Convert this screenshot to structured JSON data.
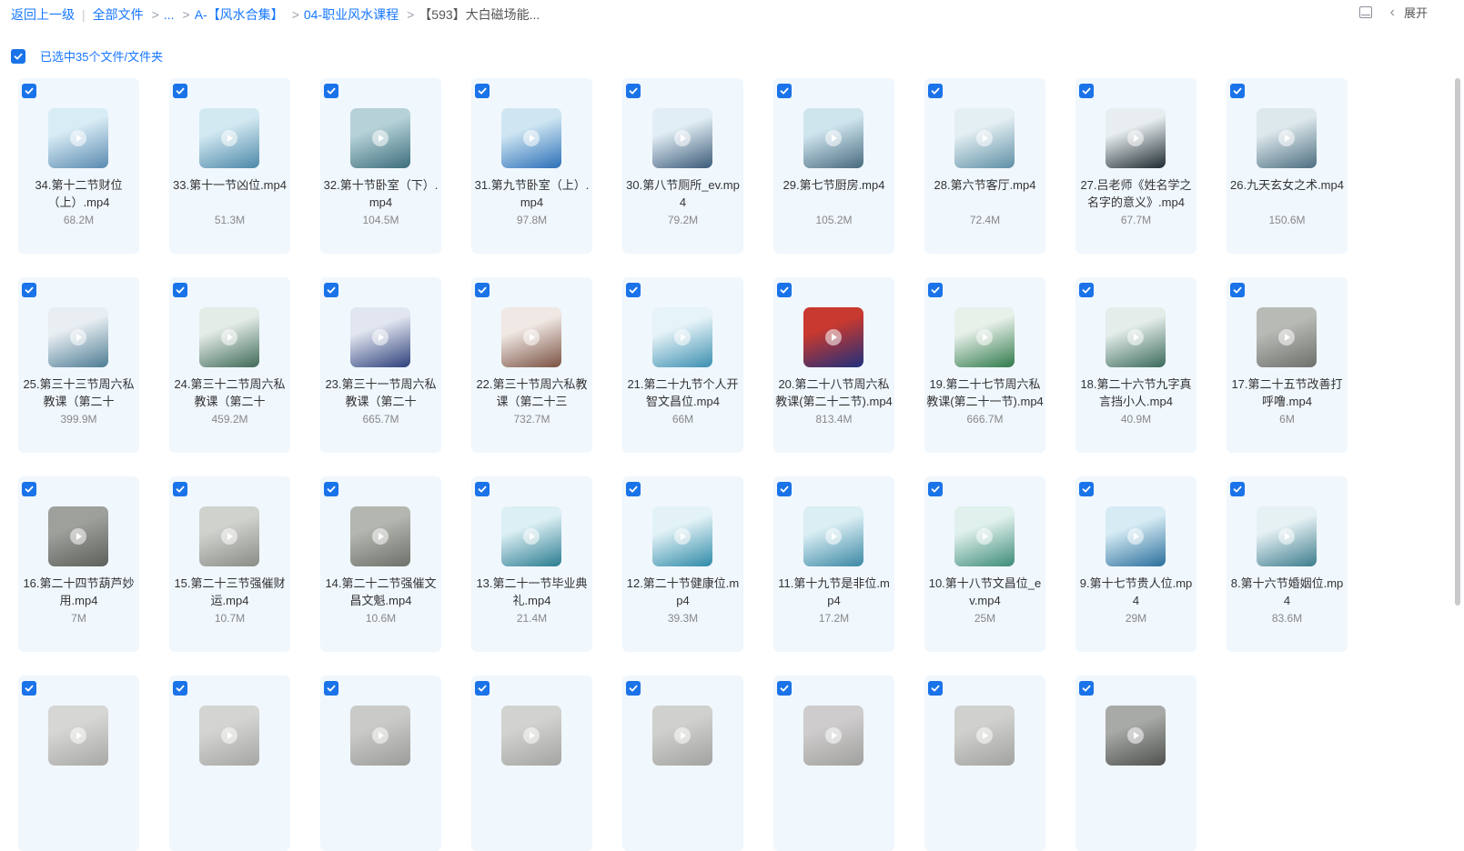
{
  "breadcrumb": {
    "back": "返回上一级",
    "all_files": "全部文件",
    "ellipsis": "...",
    "folder1": "A-【风水合集】",
    "folder2": "04-职业风水课程",
    "current": "【593】大白磁场能..."
  },
  "toolbar": {
    "expand_label": "展开",
    "view_icon": "list-view-icon",
    "collapse_icon": "chevron-left-icon"
  },
  "selection": {
    "label": "已选中35个文件/文件夹",
    "checked": true
  },
  "colors": {
    "accent": "#1677ff",
    "checkbox": "#1a73e8",
    "card_bg": "#f0f7fd"
  },
  "files": [
    {
      "name": "34.第十二节财位（上）.mp4",
      "size": "68.2M",
      "thumb": [
        "#5a8ab0",
        "#d8ecf5"
      ]
    },
    {
      "name": "33.第十一节凶位.mp4",
      "size": "51.3M",
      "thumb": [
        "#4c88a8",
        "#d3e9f2"
      ]
    },
    {
      "name": "32.第十节卧室（下）.mp4",
      "size": "104.5M",
      "thumb": [
        "#3d6e7c",
        "#b6d2d8"
      ]
    },
    {
      "name": "31.第九节卧室（上）.mp4",
      "size": "97.8M",
      "thumb": [
        "#2b6fb8",
        "#cfe6f2"
      ]
    },
    {
      "name": "30.第八节厕所_ev.mp4",
      "size": "79.2M",
      "thumb": [
        "#3b5a78",
        "#e2eef5"
      ]
    },
    {
      "name": "29.第七节厨房.mp4",
      "size": "105.2M",
      "thumb": [
        "#476a7e",
        "#cfe5ee"
      ]
    },
    {
      "name": "28.第六节客厅.mp4",
      "size": "72.4M",
      "thumb": [
        "#5e8fa5",
        "#e4eff3"
      ]
    },
    {
      "name": "27.吕老师《姓名学之名字的意义》.mp4",
      "size": "67.7M",
      "thumb": [
        "#1d2a30",
        "#e8eef0"
      ]
    },
    {
      "name": "26.九天玄女之术.mp4",
      "size": "150.6M",
      "thumb": [
        "#4c6e80",
        "#dde8ec"
      ]
    },
    {
      "name": "25.第三十三节周六私教课（第二十",
      "size": "399.9M",
      "thumb": [
        "#4e7c94",
        "#e8eef2"
      ]
    },
    {
      "name": "24.第三十二节周六私教课（第二十",
      "size": "459.2M",
      "thumb": [
        "#3f6a58",
        "#e4ece8"
      ]
    },
    {
      "name": "23.第三十一节周六私教课（第二十",
      "size": "665.7M",
      "thumb": [
        "#2c3f7a",
        "#e2e6f0"
      ]
    },
    {
      "name": "22.第三十节周六私教课（第二十三",
      "size": "732.7M",
      "thumb": [
        "#7a5242",
        "#f0e8e4"
      ]
    },
    {
      "name": "21.第二十九节个人开智文昌位.mp4",
      "size": "66M",
      "thumb": [
        "#3c8fb0",
        "#e6f3f8"
      ]
    },
    {
      "name": "20.第二十八节周六私教课(第二十二节).mp4",
      "size": "813.4M",
      "thumb": [
        "#1e2f7c",
        "#c8392f"
      ]
    },
    {
      "name": "19.第二十七节周六私教课(第二十一节).mp4",
      "size": "666.7M",
      "thumb": [
        "#2f7a4a",
        "#e8f0ea"
      ]
    },
    {
      "name": "18.第二十六节九字真言挡小人.mp4",
      "size": "40.9M",
      "thumb": [
        "#3b6a5c",
        "#e4ede9"
      ]
    },
    {
      "name": "17.第二十五节改善打呼噜.mp4",
      "size": "6M",
      "thumb": [
        "#6e706c",
        "#b8bab6"
      ]
    },
    {
      "name": "16.第二十四节葫芦妙用.mp4",
      "size": "7M",
      "thumb": [
        "#5e605c",
        "#9ea09c"
      ]
    },
    {
      "name": "15.第二十三节强催财运.mp4",
      "size": "10.7M",
      "thumb": [
        "#8a8c88",
        "#d0d2ce"
      ]
    },
    {
      "name": "14.第二十二节强催文昌文魁.mp4",
      "size": "10.6M",
      "thumb": [
        "#6e706a",
        "#b4b6b0"
      ]
    },
    {
      "name": "13.第二十一节毕业典礼.mp4",
      "size": "21.4M",
      "thumb": [
        "#2a7c90",
        "#dceff4"
      ]
    },
    {
      "name": "12.第二十节健康位.mp4",
      "size": "39.3M",
      "thumb": [
        "#2f8aa8",
        "#e2f2f6"
      ]
    },
    {
      "name": "11.第十九节是非位.mp4",
      "size": "17.2M",
      "thumb": [
        "#3a88a4",
        "#dbeef4"
      ]
    },
    {
      "name": "10.第十八节文昌位_ev.mp4",
      "size": "25M",
      "thumb": [
        "#3c8c78",
        "#e0f0ec"
      ]
    },
    {
      "name": "9.第十七节贵人位.mp4",
      "size": "29M",
      "thumb": [
        "#2a6f9c",
        "#d6ebf4"
      ]
    },
    {
      "name": "8.第十六节婚姻位.mp4",
      "size": "83.6M",
      "thumb": [
        "#3c7c8c",
        "#e6f1f4"
      ]
    },
    {
      "name": "",
      "size": "",
      "thumb": [
        "#a8a8a6",
        "#d6d6d4"
      ]
    },
    {
      "name": "",
      "size": "",
      "thumb": [
        "#a6a6a4",
        "#d4d4d2"
      ]
    },
    {
      "name": "",
      "size": "",
      "thumb": [
        "#9c9c9a",
        "#cacac8"
      ]
    },
    {
      "name": "",
      "size": "",
      "thumb": [
        "#a4a4a2",
        "#d2d2d0"
      ]
    },
    {
      "name": "",
      "size": "",
      "thumb": [
        "#a2a2a0",
        "#d0d0ce"
      ]
    },
    {
      "name": "",
      "size": "",
      "thumb": [
        "#a0a09e",
        "#cecccc"
      ]
    },
    {
      "name": "",
      "size": "",
      "thumb": [
        "#a2a2a0",
        "#d0d0ce"
      ]
    },
    {
      "name": "",
      "size": "",
      "thumb": [
        "#505250",
        "#a8aaa8"
      ]
    }
  ]
}
